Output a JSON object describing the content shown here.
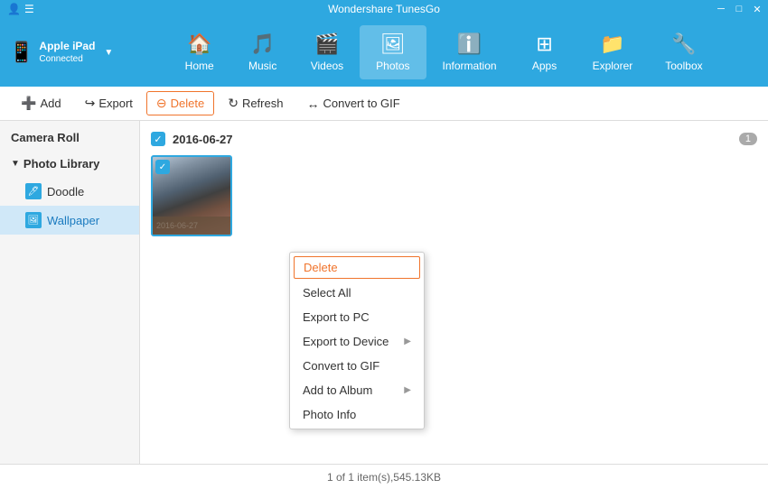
{
  "app": {
    "title": "Wondershare TunesGo"
  },
  "titlebar": {
    "controls": [
      "user-icon",
      "menu-icon",
      "minimize-icon",
      "maximize-icon",
      "close-icon"
    ]
  },
  "device": {
    "name": "Apple iPad",
    "status": "Connected",
    "icon": "📱"
  },
  "nav": {
    "items": [
      {
        "id": "home",
        "label": "Home",
        "icon": "⌂"
      },
      {
        "id": "music",
        "label": "Music",
        "icon": "♪"
      },
      {
        "id": "videos",
        "label": "Videos",
        "icon": "▶"
      },
      {
        "id": "photos",
        "label": "Photos",
        "icon": "🖼"
      },
      {
        "id": "information",
        "label": "Information",
        "icon": "ℹ"
      },
      {
        "id": "apps",
        "label": "Apps",
        "icon": "⊞"
      },
      {
        "id": "explorer",
        "label": "Explorer",
        "icon": "📁"
      },
      {
        "id": "toolbox",
        "label": "Toolbox",
        "icon": "🔧"
      }
    ],
    "active": "photos"
  },
  "toolbar": {
    "add_label": "Add",
    "export_label": "Export",
    "delete_label": "Delete",
    "refresh_label": "Refresh",
    "convert_label": "Convert to GIF"
  },
  "sidebar": {
    "camera_roll": "Camera Roll",
    "photo_library": "Photo Library",
    "items": [
      {
        "id": "doodle",
        "label": "Doodle"
      },
      {
        "id": "wallpaper",
        "label": "Wallpaper"
      }
    ],
    "active": "wallpaper"
  },
  "content": {
    "date_header": "2016-06-27",
    "count": "1",
    "photo": {
      "date_text": "2016-06-27"
    }
  },
  "context_menu": {
    "items": [
      {
        "id": "delete",
        "label": "Delete",
        "has_sub": false
      },
      {
        "id": "select-all",
        "label": "Select All",
        "has_sub": false
      },
      {
        "id": "export-pc",
        "label": "Export to PC",
        "has_sub": false
      },
      {
        "id": "export-device",
        "label": "Export to Device",
        "has_sub": true
      },
      {
        "id": "convert-gif",
        "label": "Convert to GIF",
        "has_sub": false
      },
      {
        "id": "add-album",
        "label": "Add to Album",
        "has_sub": true
      },
      {
        "id": "photo-info",
        "label": "Photo Info",
        "has_sub": false
      }
    ]
  },
  "statusbar": {
    "text": "1 of 1 item(s),545.13KB"
  }
}
